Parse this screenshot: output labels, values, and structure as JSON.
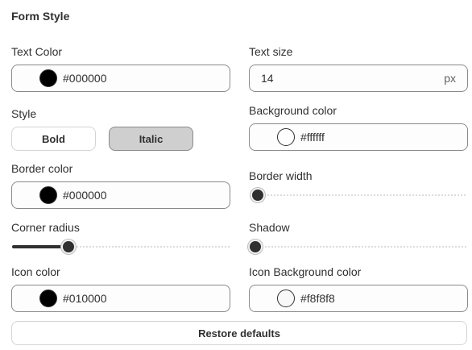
{
  "title": "Form Style",
  "text_color": {
    "label": "Text Color",
    "value": "#000000",
    "swatch": "#000000"
  },
  "text_size": {
    "label": "Text size",
    "value": "14",
    "unit": "px"
  },
  "style": {
    "label": "Style",
    "bold_label": "Bold",
    "italic_label": "Italic",
    "selected": "Italic"
  },
  "background_color": {
    "label": "Background color",
    "value": "#ffffff",
    "swatch": "#ffffff"
  },
  "border_color": {
    "label": "Border color",
    "value": "#000000",
    "swatch": "#000000"
  },
  "border_width": {
    "label": "Border width",
    "level": 0.0
  },
  "corner_radius": {
    "label": "Corner radius",
    "level": 0.26
  },
  "shadow": {
    "label": "Shadow",
    "level": 0.0
  },
  "icon_color": {
    "label": "Icon color",
    "value": "#010000",
    "swatch": "#010000"
  },
  "icon_background_color": {
    "label": "Icon Background color",
    "value": "#f8f8f8",
    "swatch": "#f8f8f8"
  },
  "restore_label": "Restore defaults"
}
